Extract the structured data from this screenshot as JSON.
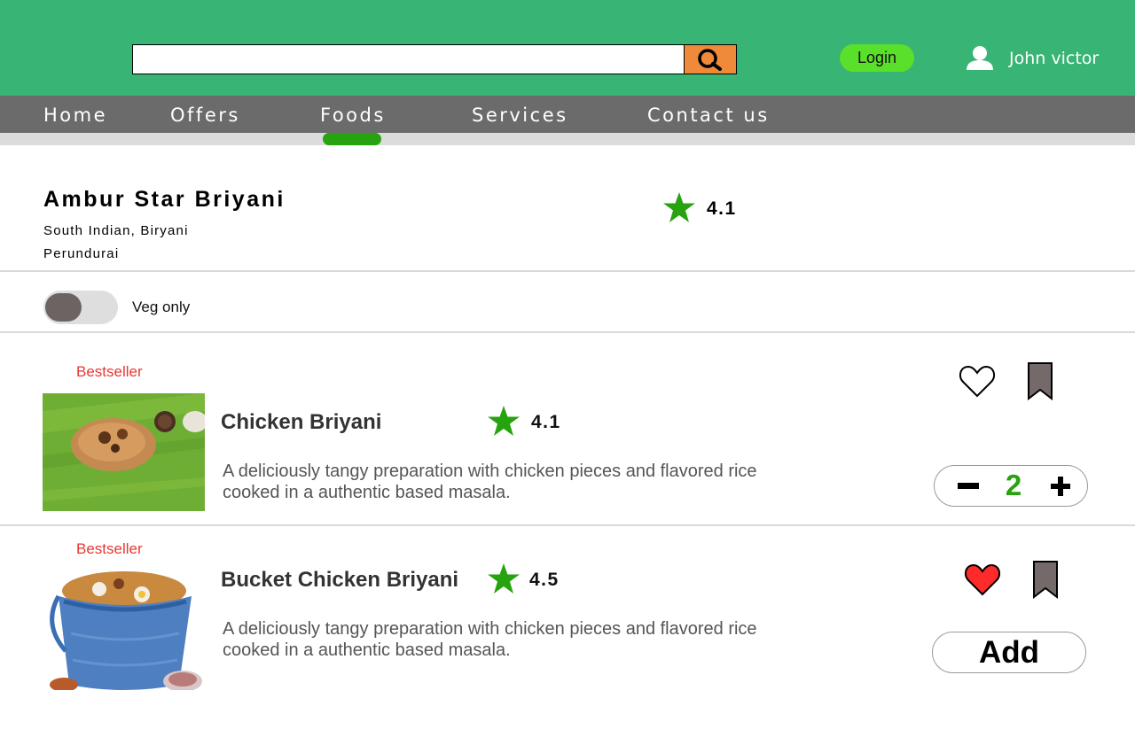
{
  "header": {
    "search": {
      "placeholder": "",
      "value": ""
    },
    "login_label": "Login",
    "user_name": "John victor"
  },
  "nav": {
    "items": [
      "Home",
      "Offers",
      "Foods",
      "Services",
      "Contact us"
    ],
    "active": "Foods"
  },
  "restaurant": {
    "name": "Ambur Star Briyani",
    "cuisine": "South Indian, Biryani",
    "location": "Perundurai",
    "rating": "4.1"
  },
  "filter": {
    "veg_only_label": "Veg only",
    "veg_only_on": false
  },
  "items": [
    {
      "badge": "Bestseller",
      "name": "Chicken Briyani",
      "rating": "4.1",
      "description": "A deliciously tangy preparation with chicken pieces and flavored rice cooked in a authentic based masala.",
      "favorite": false,
      "quantity": "2"
    },
    {
      "badge": "Bestseller",
      "name": "Bucket Chicken Briyani",
      "rating": "4.5",
      "description": "A deliciously tangy preparation with chicken pieces and flavored rice cooked in a authentic based masala.",
      "favorite": true,
      "add_label": "Add"
    }
  ],
  "colors": {
    "header_bg": "#38b474",
    "nav_bg": "#6b6b6b",
    "accent_green": "#27a30f",
    "login_bg": "#5ae02a",
    "search_btn": "#ef8a3a",
    "bestseller": "#e53935",
    "favorite_red": "#ff2a2a"
  },
  "icons": {
    "search": "search-icon",
    "user": "user-icon",
    "star": "star-icon",
    "heart": "heart-icon",
    "bookmark": "bookmark-icon"
  }
}
